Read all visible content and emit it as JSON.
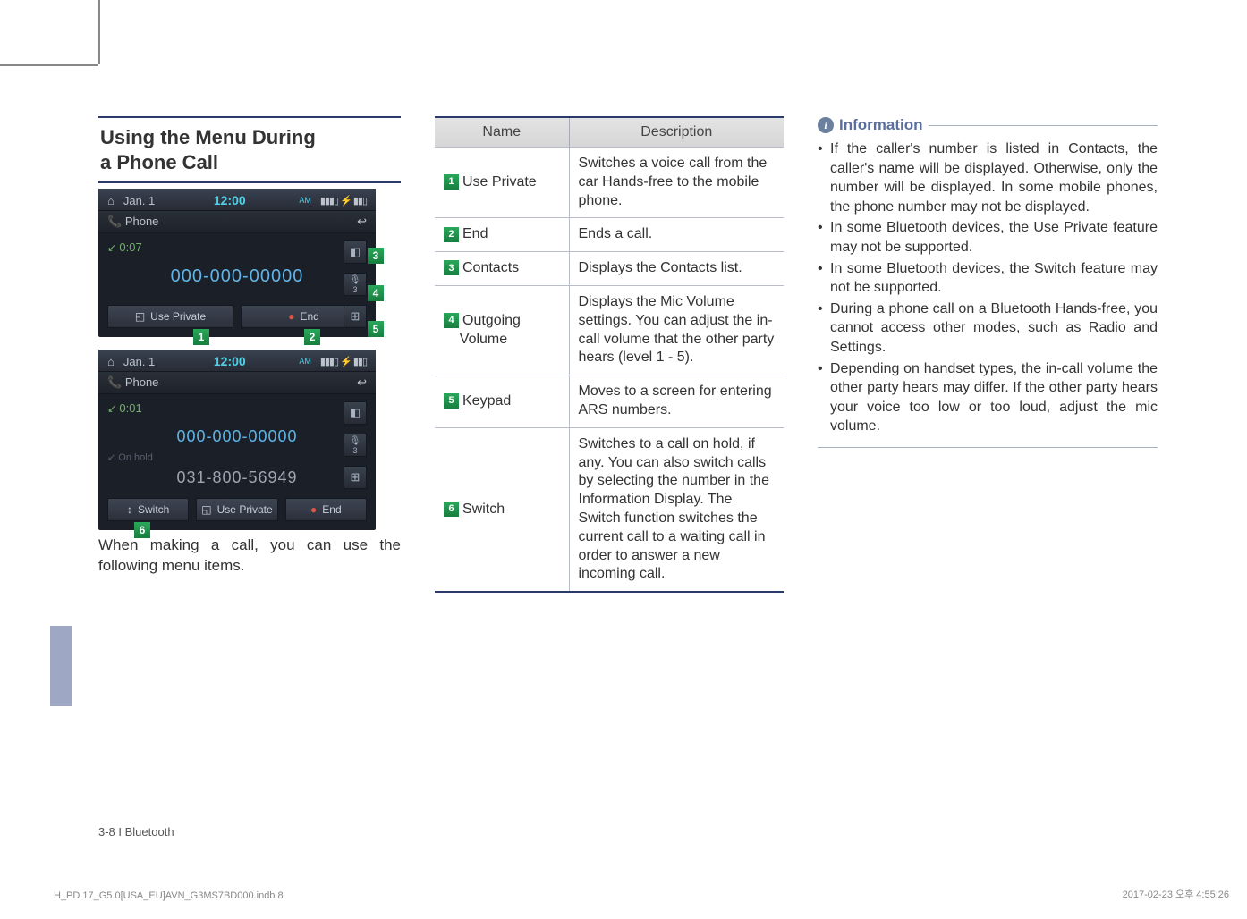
{
  "section_title_line1": "Using the Menu During",
  "section_title_line2": "a Phone Call",
  "screenshot1": {
    "date": "Jan.  1",
    "time": "12:00",
    "ampm": "AM",
    "crumb": "Phone",
    "back": "↩",
    "duration": "0:07",
    "number": "000-000-00000",
    "btn_use_private": "Use Private",
    "btn_end": "End",
    "icon_contacts": "◧",
    "icon_mic": "🎙",
    "mic_level": "3",
    "icon_keypad": "⊞"
  },
  "screenshot2": {
    "date": "Jan.  1",
    "time": "12:00",
    "ampm": "AM",
    "crumb": "Phone",
    "back": "↩",
    "duration": "0:01",
    "number1": "000-000-00000",
    "hold_label": "On hold",
    "number2": "031-800-56949",
    "btn_switch": "Switch",
    "btn_use_private": "Use Private",
    "btn_end": "End",
    "mic_level": "3"
  },
  "callouts": {
    "c1": "1",
    "c2": "2",
    "c3": "3",
    "c4": "4",
    "c5": "5",
    "c6": "6"
  },
  "body_text": "When making a call, you can use the following menu items.",
  "table": {
    "head_name": "Name",
    "head_desc": "Description",
    "rows": [
      {
        "n": "1",
        "name": "Use Private",
        "desc": "Switches a voice call from the car Hands-free to the mobile phone."
      },
      {
        "n": "2",
        "name": "End",
        "desc": "Ends a call."
      },
      {
        "n": "3",
        "name": "Contacts",
        "desc": "Displays the Contacts list."
      },
      {
        "n": "4",
        "name": "Outgoing Volume",
        "desc": "Displays the Mic Volume settings. You can adjust the in-call volume that the other party hears (level 1 - 5)."
      },
      {
        "n": "5",
        "name": "Keypad",
        "desc": "Moves to a screen for entering ARS numbers."
      },
      {
        "n": "6",
        "name": "Switch",
        "desc": "Switches to a call on hold, if any. You can also switch calls by selecting the number in the Information Display. The Switch function switches the current call to a waiting call in order to answer a new incoming call."
      }
    ]
  },
  "info_title": "Information",
  "info_items": [
    "If the caller's number is listed in Contacts, the caller's name will be displayed. Otherwise, only the number will be displayed. In some mobile phones, the phone number may not be displayed.",
    "In some Bluetooth devices, the Use Private feature may not be supported.",
    "In some Bluetooth devices, the Switch feature may not be supported.",
    "During a phone call on a Bluetooth Hands-free, you cannot access other modes, such as Radio and Settings.",
    "Depending on handset types, the in-call volume the other party hears may differ. If the other party hears your voice too low or too loud, adjust the mic volume."
  ],
  "footer": "3-8 I Bluetooth",
  "print_left": "H_PD 17_G5.0[USA_EU]AVN_G3MS7BD000.indb   8",
  "print_right": "2017-02-23   오후 4:55:26"
}
